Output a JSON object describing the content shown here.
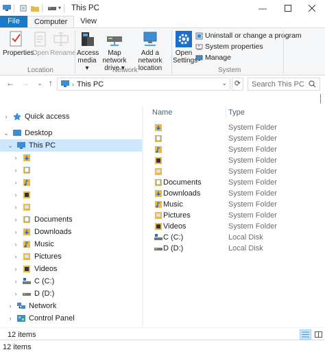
{
  "window": {
    "title": "This PC"
  },
  "tabs": {
    "file": "File",
    "computer": "Computer",
    "view": "View"
  },
  "ribbon": {
    "properties": "Properties",
    "open": "Open",
    "rename": "Rename",
    "access_media_1": "Access",
    "access_media_2": "media ▾",
    "map_drive_1": "Map network",
    "map_drive_2": "drive ▾",
    "add_location_1": "Add a network",
    "add_location_2": "location",
    "open_settings_1": "Open",
    "open_settings_2": "Settings",
    "uninstall": "Uninstall or change a program",
    "system_properties": "System properties",
    "manage": "Manage",
    "group_location": "Location",
    "group_network": "Network",
    "group_system": "System"
  },
  "address": {
    "path": "This PC",
    "search_placeholder": "Search This PC"
  },
  "navpane": {
    "quick_access": "Quick access",
    "desktop": "Desktop",
    "this_pc": "This PC",
    "documents": "Documents",
    "downloads": "Downloads",
    "music": "Music",
    "pictures": "Pictures",
    "videos": "Videos",
    "c_drive": "C (C:)",
    "d_drive": "D (D:)",
    "network": "Network",
    "control_panel": "Control Panel"
  },
  "content": {
    "col_name": "Name",
    "col_type": "Type",
    "rows": [
      {
        "name": "",
        "type": "System Folder",
        "icon": "downloads-folder-icon"
      },
      {
        "name": "",
        "type": "System Folder",
        "icon": "documents-folder-icon"
      },
      {
        "name": "",
        "type": "System Folder",
        "icon": "music-folder-icon"
      },
      {
        "name": "",
        "type": "System Folder",
        "icon": "videos-folder-icon"
      },
      {
        "name": "",
        "type": "System Folder",
        "icon": "pictures-folder-icon"
      },
      {
        "name": "Documents",
        "type": "System Folder",
        "icon": "documents-folder-icon"
      },
      {
        "name": "Downloads",
        "type": "System Folder",
        "icon": "downloads-folder-icon"
      },
      {
        "name": "Music",
        "type": "System Folder",
        "icon": "music-folder-icon"
      },
      {
        "name": "Pictures",
        "type": "System Folder",
        "icon": "pictures-folder-icon"
      },
      {
        "name": "Videos",
        "type": "System Folder",
        "icon": "videos-folder-icon"
      },
      {
        "name": "C (C:)",
        "type": "Local Disk",
        "icon": "windows-drive-icon"
      },
      {
        "name": "D (D:)",
        "type": "Local Disk",
        "icon": "drive-icon"
      }
    ]
  },
  "status": {
    "count": "12 items",
    "count2": "12 items"
  },
  "colors": {
    "accent": "#1979ca",
    "selection": "#cce8ff",
    "folder": "#e8b84a"
  }
}
